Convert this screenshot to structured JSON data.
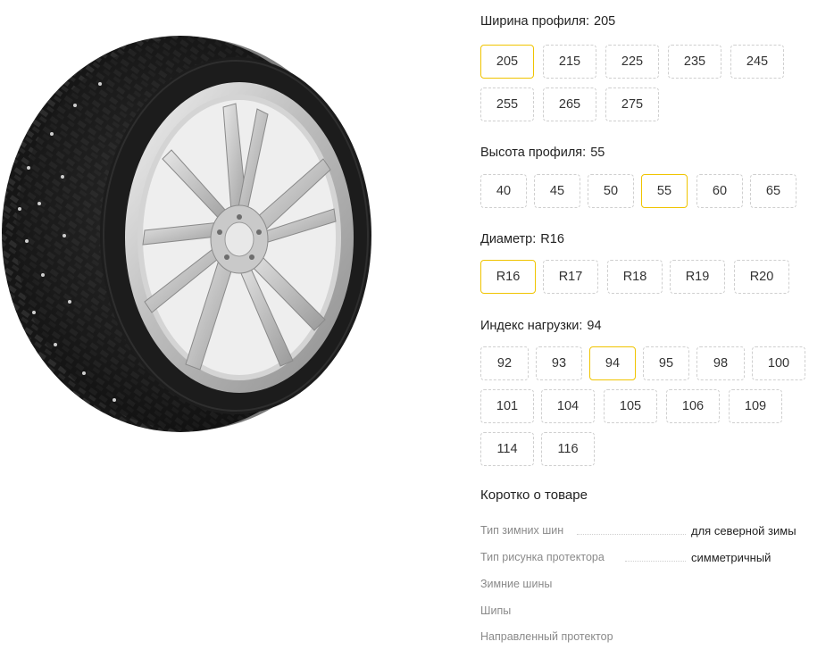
{
  "groups": [
    {
      "label": "Ширина профиля:",
      "value": "205",
      "options": [
        "205",
        "215",
        "225",
        "235",
        "245",
        "255",
        "265",
        "275"
      ],
      "selected": "205"
    },
    {
      "label": "Высота профиля:",
      "value": "55",
      "options": [
        "40",
        "45",
        "50",
        "55",
        "60",
        "65"
      ],
      "selected": "55"
    },
    {
      "label": "Диаметр:",
      "value": "R16",
      "options": [
        "R16",
        "R17",
        "R18",
        "R19",
        "R20"
      ],
      "selected": "R16"
    },
    {
      "label": "Индекс нагрузки:",
      "value": "94",
      "options": [
        "92",
        "93",
        "94",
        "95",
        "98",
        "100",
        "101",
        "104",
        "105",
        "106",
        "109",
        "114",
        "116"
      ],
      "selected": "94"
    }
  ],
  "summary": {
    "title": "Коротко о товаре",
    "specs": [
      {
        "key": "Тип зимних шин",
        "value": "для северной зимы"
      },
      {
        "key": "Тип рисунка протектора",
        "value": "симметричный"
      },
      {
        "key": "Зимние шины",
        "value": ""
      },
      {
        "key": "Шипы",
        "value": ""
      },
      {
        "key": "Направленный протектор",
        "value": ""
      }
    ]
  },
  "colors": {
    "selected_border": "#f0c400",
    "chip_border": "#cfcfcf",
    "muted_text": "#8a8a8a"
  },
  "image": {
    "icon": "studded-winter-tire-image"
  }
}
